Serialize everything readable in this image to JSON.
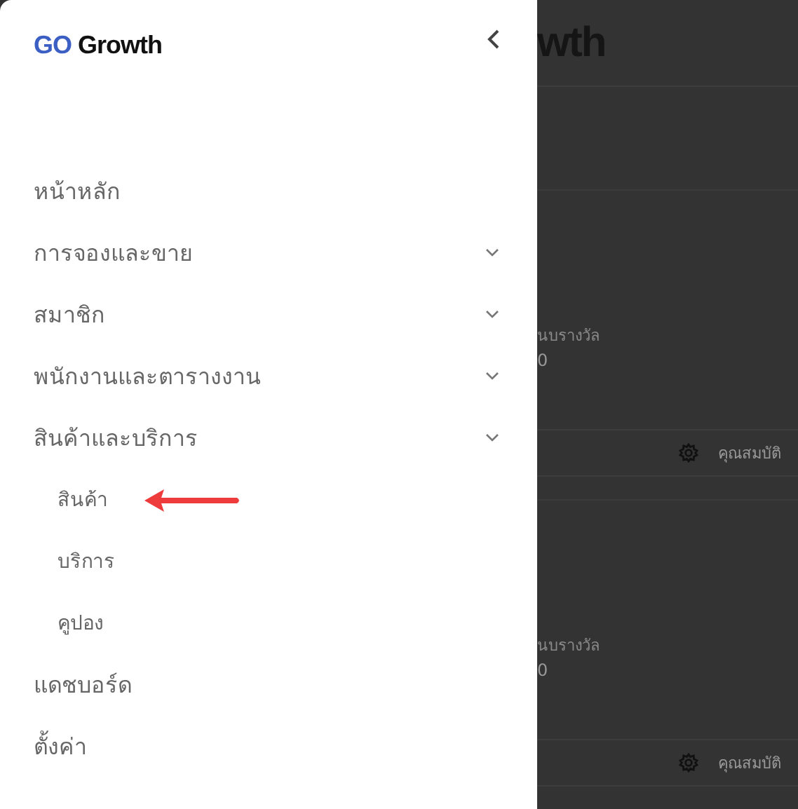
{
  "logo": {
    "accent": "GO",
    "text": "Growth"
  },
  "menu": [
    {
      "label": "หน้าหลัก",
      "kind": "link"
    },
    {
      "label": "การจองและขาย",
      "kind": "group"
    },
    {
      "label": "สมาชิก",
      "kind": "group"
    },
    {
      "label": "พนักงานและตารางงาน",
      "kind": "group"
    },
    {
      "label": "สินค้าและบริการ",
      "kind": "group",
      "children": [
        {
          "label": "สินค้า",
          "pointed": true
        },
        {
          "label": "บริการ",
          "pointed": false
        },
        {
          "label": "คูปอง",
          "pointed": false
        }
      ]
    },
    {
      "label": "แดชบอร์ด",
      "kind": "link"
    },
    {
      "label": "ตั้งค่า",
      "kind": "link"
    }
  ],
  "background": {
    "title": "wth",
    "cards": [
      {
        "caption": "นบรางวัล",
        "value": "0",
        "action": "คุณสมบัติ"
      },
      {
        "caption": "นบรางวัล",
        "value": "0",
        "action": "คุณสมบัติ"
      }
    ]
  }
}
